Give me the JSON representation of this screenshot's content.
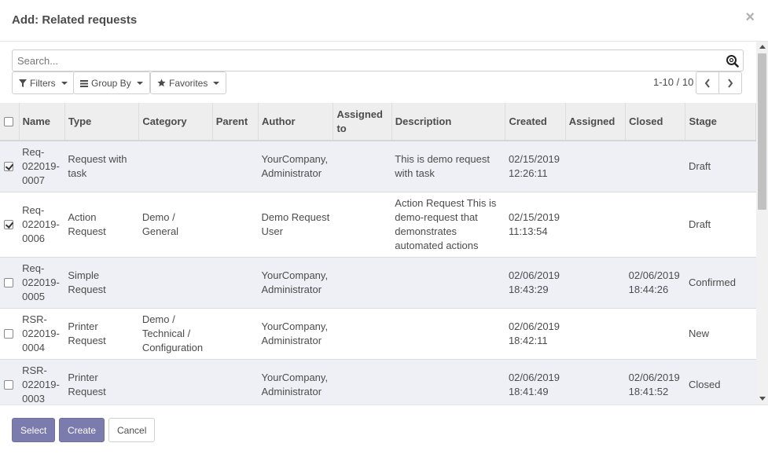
{
  "dialog": {
    "title": "Add: Related requests",
    "close_glyph": "×"
  },
  "search": {
    "placeholder": "Search...",
    "value": "",
    "icon": "search-icon"
  },
  "filters": {
    "filters_label": "Filters",
    "group_by_label": "Group By",
    "favorites_label": "Favorites"
  },
  "pager": {
    "value": "1-10 / 10"
  },
  "table": {
    "headers": {
      "name": "Name",
      "type": "Type",
      "category": "Category",
      "parent": "Parent",
      "author": "Author",
      "assigned_to": "Assigned to",
      "description": "Description",
      "created": "Created",
      "assigned": "Assigned",
      "closed": "Closed",
      "stage": "Stage"
    },
    "rows": [
      {
        "checked": true,
        "name": "Req-022019-0007",
        "type": "Request with task",
        "category": "",
        "parent": "",
        "author": "YourCompany, Administrator",
        "assigned_to": "",
        "description": "This is demo request with task",
        "created": "02/15/2019 12:26:11",
        "assigned": "",
        "closed": "",
        "stage": "Draft"
      },
      {
        "checked": true,
        "name": "Req-022019-0006",
        "type": "Action Request",
        "category": "Demo / General",
        "parent": "",
        "author": "Demo Request User",
        "assigned_to": "",
        "description": "Action Request This is demo-request that demonstrates automated actions",
        "created": "02/15/2019 11:13:54",
        "assigned": "",
        "closed": "",
        "stage": "Draft"
      },
      {
        "checked": false,
        "name": "Req-022019-0005",
        "type": "Simple Request",
        "category": "",
        "parent": "",
        "author": "YourCompany, Administrator",
        "assigned_to": "",
        "description": "",
        "created": "02/06/2019 18:43:29",
        "assigned": "",
        "closed": "02/06/2019 18:44:26",
        "stage": "Confirmed"
      },
      {
        "checked": false,
        "name": "RSR-022019-0004",
        "type": "Printer Request",
        "category": "Demo / Technical / Configuration",
        "parent": "",
        "author": "YourCompany, Administrator",
        "assigned_to": "",
        "description": "",
        "created": "02/06/2019 18:42:11",
        "assigned": "",
        "closed": "",
        "stage": "New"
      },
      {
        "checked": false,
        "name": "RSR-022019-0003",
        "type": "Printer Request",
        "category": "",
        "parent": "",
        "author": "YourCompany, Administrator",
        "assigned_to": "",
        "description": "",
        "created": "02/06/2019 18:41:49",
        "assigned": "",
        "closed": "02/06/2019 18:41:52",
        "stage": "Closed"
      }
    ]
  },
  "footer": {
    "select_label": "Select",
    "create_label": "Create",
    "cancel_label": "Cancel"
  },
  "colors": {
    "primary": "#7c7bad",
    "row_alt": "#eef0f6",
    "header_bg": "#eeeeee"
  }
}
